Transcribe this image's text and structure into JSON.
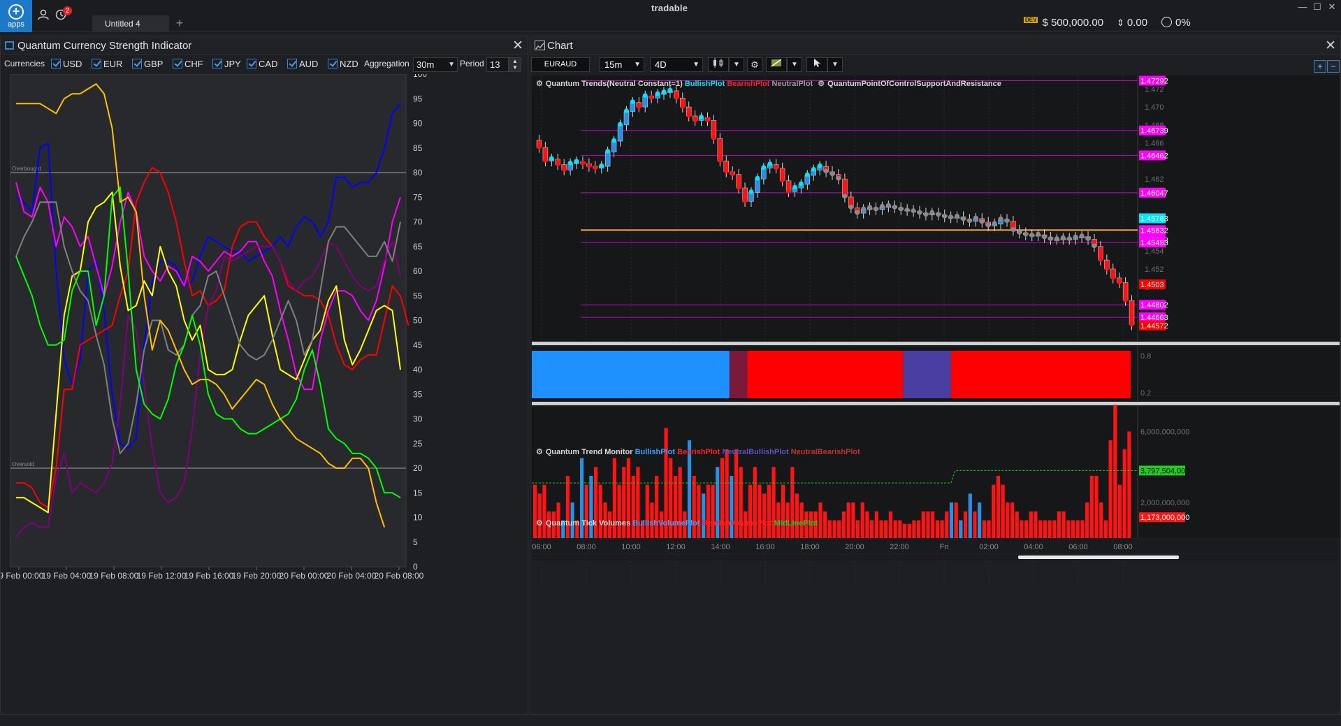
{
  "app": {
    "brand": "tradable",
    "apps_label": "apps",
    "notifications_count": "2",
    "workspace_tab": "Untitled 4",
    "tab_add": "+",
    "win_min": "—",
    "win_max": "☐",
    "win_close": "✕"
  },
  "account": {
    "dev_badge": "DEV",
    "balance": "$ 500,000.00",
    "pnl": "0.00",
    "margin": "0%"
  },
  "strength_panel": {
    "title": "Quantum Currency Strength Indicator",
    "close": "✕",
    "currencies_label": "Currencies",
    "currencies": [
      {
        "code": "USD",
        "color": "#0000ff",
        "checked": true
      },
      {
        "code": "EUR",
        "color": "#ff0000",
        "checked": true
      },
      {
        "code": "GBP",
        "color": "#ff00ff",
        "checked": true
      },
      {
        "code": "CHF",
        "color": "#800080",
        "checked": true
      },
      {
        "code": "JPY",
        "color": "#ffff00",
        "checked": true
      },
      {
        "code": "CAD",
        "color": "#808080",
        "checked": true
      },
      {
        "code": "AUD",
        "color": "#00ff00",
        "checked": true
      },
      {
        "code": "NZD",
        "color": "#ffc000",
        "checked": true
      }
    ],
    "aggregation_label": "Aggregation",
    "aggregation_value": "30m",
    "period_label": "Period",
    "period_value": "13",
    "chart_data": {
      "type": "line",
      "ylim": [
        0,
        100
      ],
      "yticks": [
        "100",
        "95",
        "90",
        "85",
        "80",
        "75",
        "70",
        "65",
        "60",
        "55",
        "50",
        "45",
        "40",
        "35",
        "30",
        "25",
        "20",
        "15",
        "10",
        "5",
        "0"
      ],
      "xticks": [
        "19 Feb 00:00",
        "19 Feb 04:00",
        "19 Feb 08:00",
        "19 Feb 12:00",
        "19 Feb 16:00",
        "19 Feb 20:00",
        "20 Feb 00:00",
        "20 Feb 04:00",
        "20 Feb 08:00"
      ],
      "overbought_label": "Overbought",
      "overbought": 80,
      "oversold_label": "Oversold",
      "oversold": 20,
      "series": [
        {
          "name": "USD",
          "color": "#0000ff",
          "values": [
            75,
            74,
            72,
            85,
            86,
            60,
            42,
            37,
            42,
            60,
            62,
            52,
            35,
            25,
            24,
            26,
            45,
            58,
            62,
            62,
            61,
            57,
            58,
            63,
            67,
            66,
            65,
            64,
            64,
            62,
            63,
            64,
            65,
            67,
            65,
            69,
            71,
            70,
            67,
            70,
            79,
            79,
            77,
            78,
            78,
            80,
            85,
            92,
            94
          ]
        },
        {
          "name": "EUR",
          "color": "#ff0000",
          "values": [
            17,
            17,
            16,
            13,
            12,
            20,
            36,
            36,
            45,
            46,
            47,
            48,
            49,
            55,
            60,
            74,
            78,
            81,
            80,
            76,
            70,
            62,
            55,
            56,
            53,
            54,
            56,
            65,
            69,
            70,
            70,
            67,
            65,
            62,
            57,
            56,
            55,
            55,
            54,
            51,
            45,
            41,
            40,
            42,
            43,
            43,
            50,
            57,
            55,
            49
          ]
        },
        {
          "name": "GBP",
          "color": "#ff00ff",
          "values": [
            78,
            72,
            71,
            77,
            74,
            65,
            71,
            69,
            65,
            67,
            61,
            55,
            61,
            70,
            76,
            72,
            63,
            60,
            58,
            61,
            60,
            57,
            63,
            62,
            60,
            62,
            64,
            63,
            64,
            66,
            66,
            62,
            59,
            52,
            46,
            39,
            36,
            36,
            46,
            52,
            56,
            56,
            55,
            52,
            50,
            54,
            61,
            70,
            75
          ]
        },
        {
          "name": "CHF",
          "color": "#800080",
          "values": [
            6,
            8,
            9,
            8,
            8,
            18,
            23,
            15,
            17,
            16,
            15,
            17,
            21,
            33,
            51,
            48,
            37,
            24,
            15,
            13,
            14,
            17,
            28,
            43,
            53,
            56,
            63,
            62,
            63,
            64,
            65,
            65,
            65,
            62,
            58,
            56,
            58,
            59,
            62,
            66,
            65,
            62,
            59,
            57,
            56,
            57,
            62,
            66,
            59
          ]
        },
        {
          "name": "JPY",
          "color": "#ffff00",
          "values": [
            14,
            14,
            13,
            12,
            11,
            31,
            51,
            59,
            60,
            70,
            73,
            74,
            76,
            61,
            52,
            53,
            58,
            55,
            65,
            60,
            57,
            50,
            46,
            49,
            40,
            39,
            39,
            40,
            46,
            51,
            53,
            55,
            47,
            40,
            39,
            38,
            42,
            46,
            48,
            54,
            57,
            46,
            41,
            44,
            48,
            52,
            53,
            52,
            40
          ]
        },
        {
          "name": "CAD",
          "color": "#808080",
          "values": [
            63,
            67,
            70,
            74,
            74,
            74,
            65,
            60,
            56,
            54,
            47,
            41,
            30,
            23,
            25,
            33,
            44,
            50,
            50,
            44,
            43,
            45,
            51,
            53,
            59,
            60,
            55,
            50,
            45,
            43,
            42,
            43,
            46,
            50,
            54,
            50,
            43,
            46,
            56,
            66,
            69,
            69,
            67,
            65,
            63,
            63,
            66,
            62,
            70
          ]
        },
        {
          "name": "AUD",
          "color": "#00ff00",
          "values": [
            63,
            59,
            55,
            49,
            45,
            45,
            46,
            56,
            60,
            60,
            49,
            55,
            75,
            77,
            60,
            40,
            33,
            31,
            30,
            34,
            41,
            45,
            51,
            45,
            35,
            31,
            30,
            30,
            28,
            27,
            27,
            28,
            29,
            30,
            31,
            34,
            40,
            44,
            37,
            28,
            26,
            25,
            23,
            23,
            22,
            20,
            15,
            15,
            14
          ]
        },
        {
          "name": "NZD",
          "color": "#ffc000",
          "values": [
            94,
            94,
            94,
            94,
            93,
            92,
            95,
            96,
            96,
            97,
            98,
            96,
            89,
            74,
            75,
            72,
            55,
            44,
            50,
            48,
            44,
            40,
            37,
            38,
            38,
            37,
            35,
            32,
            34,
            36,
            38,
            37,
            33,
            30,
            28,
            26,
            25,
            24,
            23,
            21,
            20,
            20,
            22,
            22,
            20,
            13,
            8
          ]
        }
      ]
    }
  },
  "chart_panel": {
    "title": "Chart",
    "close": "✕",
    "symbol": "EURAUD",
    "timeframe": "15m",
    "range": "4D",
    "chart_type_icon": "candles-icon",
    "zoom_in": "+",
    "zoom_out": "−",
    "price_pane": {
      "legend_main": "Quantum Trends(Neutral Constant=1)",
      "legend_bull": "BullishPlot",
      "legend_bear": "BearishPlot",
      "legend_neutral": "NeutralPlot",
      "legend_poc": "QuantumPointOfControlSupportAndResistance",
      "ylim": [
        1.444,
        1.4735
      ],
      "yticks": [
        "1.472",
        "1.470",
        "1.468",
        "1.466",
        "1.462",
        "1.454",
        "1.452",
        "1.450"
      ],
      "price_labels": [
        {
          "value": "1.47292",
          "color": "#ff00ff"
        },
        {
          "value": "1.46739",
          "color": "#ff00ff"
        },
        {
          "value": "1.46462",
          "color": "#ff00ff"
        },
        {
          "value": "1.46047",
          "color": "#ff00ff"
        },
        {
          "value": "1.45763",
          "color": "#00e5ff"
        },
        {
          "value": "1.45632",
          "color": "#ff00ff"
        },
        {
          "value": "1.45522",
          "color": "#ff00ff"
        },
        {
          "value": "1.45493",
          "color": "#ff00ff"
        },
        {
          "value": "1.4503",
          "color": "#ff0000"
        },
        {
          "value": "1.44802",
          "color": "#ff00ff"
        },
        {
          "value": "1.44663",
          "color": "#ff00ff"
        },
        {
          "value": "1.44572",
          "color": "#ff0000"
        }
      ],
      "levels": [
        1.47292,
        1.46739,
        1.46462,
        1.46047,
        1.45493,
        1.44802,
        1.44663
      ],
      "poc_level": 1.45632,
      "closes": [
        1.4655,
        1.464,
        1.4642,
        1.4636,
        1.463,
        1.4637,
        1.4639,
        1.4637,
        1.4634,
        1.4632,
        1.4634,
        1.465,
        1.4662,
        1.468,
        1.4695,
        1.4705,
        1.47,
        1.4712,
        1.471,
        1.4714,
        1.4716,
        1.4718,
        1.471,
        1.47,
        1.469,
        1.4685,
        1.4688,
        1.4685,
        1.4665,
        1.464,
        1.4628,
        1.4625,
        1.461,
        1.4595,
        1.4605,
        1.462,
        1.4632,
        1.4636,
        1.4632,
        1.4618,
        1.4606,
        1.461,
        1.4614,
        1.4624,
        1.463,
        1.4634,
        1.4628,
        1.4625,
        1.462,
        1.46,
        1.4588,
        1.4582,
        1.4586,
        1.4588,
        1.4586,
        1.4589,
        1.459,
        1.4588,
        1.4586,
        1.4585,
        1.4584,
        1.4582,
        1.458,
        1.4582,
        1.458,
        1.4578,
        1.4577,
        1.4578,
        1.4575,
        1.4573,
        1.4576,
        1.4572,
        1.4568,
        1.457,
        1.4575,
        1.4573,
        1.4563,
        1.456,
        1.4558,
        1.4557,
        1.4558,
        1.4555,
        1.4553,
        1.4553,
        1.4554,
        1.4553,
        1.4555,
        1.4556,
        1.4553,
        1.4545,
        1.453,
        1.452,
        1.451,
        1.4505,
        1.4485,
        1.4458
      ]
    },
    "trend_monitor": {
      "legend_main": "Quantum Trend Monitor",
      "legend_bull": "BullishPlot",
      "legend_bear": "BearishPlot",
      "legend_nbull": "NeutralBullishPlot",
      "legend_nbear": "NeutralBearishPlot",
      "yticks": [
        "0.8",
        "0.2"
      ],
      "segments": [
        {
          "from": 0,
          "to": 0.33,
          "color": "#1e90ff"
        },
        {
          "from": 0.33,
          "to": 0.36,
          "color": "#7a1a3a"
        },
        {
          "from": 0.36,
          "to": 0.62,
          "color": "#ff0000"
        },
        {
          "from": 0.62,
          "to": 0.7,
          "color": "#4a3fa0"
        },
        {
          "from": 0.7,
          "to": 1.0,
          "color": "#ff0000"
        }
      ]
    },
    "volume_pane": {
      "legend_main": "Quantum Tick Volumes",
      "legend_bull": "BullishVolumePlot",
      "legend_bear": "BearishVolumePlot",
      "legend_mid": "MidLinePlot",
      "ylim": [
        0,
        7000000000
      ],
      "yticks": [
        "6,000,000,000",
        "2,000,000,000"
      ],
      "mid_label": "3,797,504,000",
      "last_label": "1,173,000,000",
      "mid_before": 3100000000,
      "mid_after": 3797504000,
      "volumes": [
        3,
        2.5,
        3,
        1.5,
        1.5,
        2,
        1,
        3.5,
        2,
        1,
        4.5,
        3,
        3.5,
        4,
        3,
        2,
        1.5,
        4.5,
        3,
        4,
        4.5,
        3.5,
        4,
        1,
        3,
        2,
        3.5,
        1.5,
        6.2,
        4.5,
        3.5,
        4,
        1.5,
        5.5,
        3.5,
        3,
        2.5,
        3,
        3,
        4,
        4.5,
        5,
        3.5,
        5,
        4,
        1.5,
        3,
        4,
        3,
        2.5,
        3,
        4,
        2,
        3,
        2,
        4,
        2.5,
        2,
        1.5,
        1.5,
        1.5,
        2,
        1.5,
        1,
        1,
        1,
        1.5,
        2,
        2,
        1,
        2,
        1.5,
        1,
        1.5,
        1,
        1,
        1.5,
        1,
        1,
        0.8,
        0.8,
        1,
        1,
        1.5,
        1.5,
        1.5,
        1,
        1,
        1.5,
        2,
        2,
        1,
        1.5,
        2.5,
        1.5,
        2,
        1,
        1,
        3,
        3.5,
        3,
        2,
        2,
        1.5,
        1,
        1,
        1.5,
        1.5,
        1,
        1,
        1,
        1,
        1.5,
        1.5,
        1,
        1,
        1,
        1,
        2,
        3.5,
        3.5,
        2,
        1,
        5.5,
        7.5,
        3,
        5,
        6
      ]
    },
    "time_axis": [
      "06:00",
      "08:00",
      "10:00",
      "12:00",
      "14:00",
      "16:00",
      "18:00",
      "20:00",
      "22:00",
      "Fri",
      "02:00",
      "04:00",
      "06:00",
      "08:00"
    ]
  }
}
